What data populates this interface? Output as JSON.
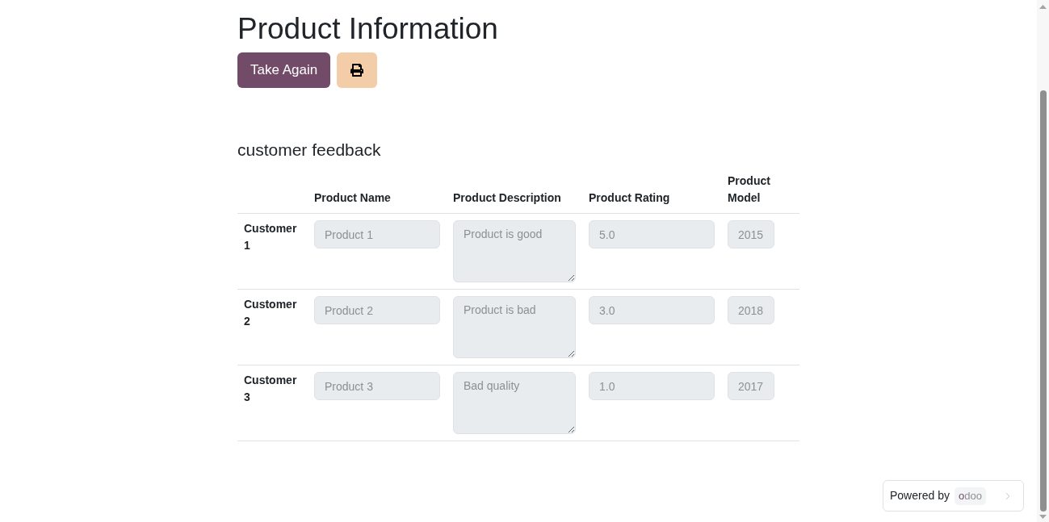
{
  "page": {
    "title": "Product Information",
    "buttons": [
      {
        "kind": "primary",
        "label": "Take Again"
      },
      {
        "kind": "print"
      }
    ]
  },
  "section": {
    "title": "customer feedback",
    "table": {
      "columns": [
        "Product Name",
        "Product Description",
        "Product Rating",
        "Product Model"
      ],
      "rows": [
        {
          "customer": "Customer 1",
          "cells": [
            {
              "kind": "input",
              "value": "Product 1",
              "disabled": true
            },
            {
              "kind": "textarea",
              "value": "Product is good",
              "disabled": true
            },
            {
              "kind": "input",
              "value": "5.0",
              "disabled": true
            },
            {
              "kind": "input",
              "value": "2015",
              "disabled": true
            }
          ]
        },
        {
          "customer": "Customer 2",
          "cells": [
            {
              "kind": "input",
              "value": "Product 2",
              "disabled": true
            },
            {
              "kind": "textarea",
              "value": "Product is bad",
              "disabled": true
            },
            {
              "kind": "input",
              "value": "3.0",
              "disabled": true
            },
            {
              "kind": "input",
              "value": "2018",
              "disabled": true
            }
          ]
        },
        {
          "customer": "Customer 3",
          "cells": [
            {
              "kind": "input",
              "value": "Product 3",
              "disabled": true
            },
            {
              "kind": "textarea",
              "value": "Bad quality",
              "disabled": true
            },
            {
              "kind": "input",
              "value": "1.0",
              "disabled": true
            },
            {
              "kind": "input",
              "value": "2017",
              "disabled": true
            }
          ]
        }
      ]
    }
  },
  "footer_badge": {
    "label": "Powered by",
    "logo_text": "odoo"
  }
}
